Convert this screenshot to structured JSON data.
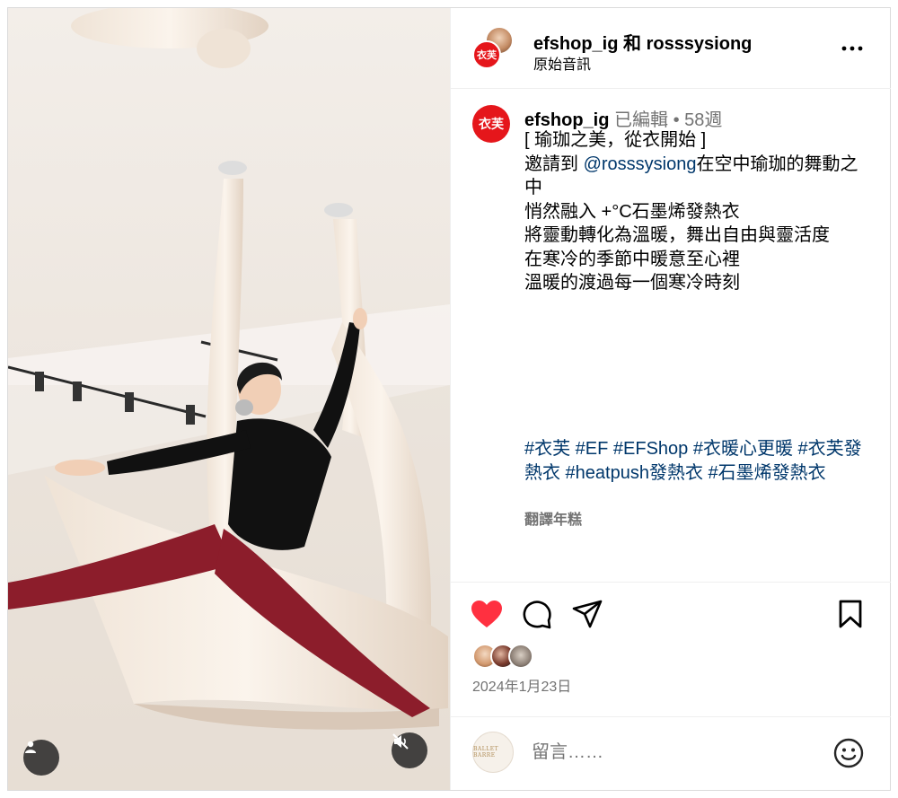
{
  "post": {
    "media": {
      "alt_scene": "aerial-yoga",
      "user_button_icon": "user-icon",
      "mute_button_icon": "muted-speaker-icon"
    },
    "header": {
      "collab_avatar_text": "衣芙",
      "title": "efshop_ig 和 rosssysiong",
      "subtitle": "原始音訊",
      "more_icon": "more-horizontal-icon"
    },
    "caption": {
      "avatar_text": "衣芙",
      "username": "efshop_ig",
      "edited": "已編輯",
      "dot": "•",
      "age": "58週",
      "lines": [
        "[ 瑜珈之美，從衣開始 ]",
        "在空中瑜珈的舞動之中",
        "悄然融入 +°C石墨烯發熱衣",
        "將靈動轉化為溫暖，舞出自由與靈活度",
        "在寒冷的季節中暖意至心裡",
        "溫暖的渡過每一個寒冷時刻"
      ],
      "invite_prefix": "邀請到 ",
      "mention": "@rosssysiong",
      "hashtags": "#衣芙 #EF #EFShop #衣暖心更暖 #衣芙發熱衣 #heatpush發熱衣 #石墨烯發熱衣",
      "translate": "翻譯年糕"
    },
    "actions": {
      "like_icon": "heart-filled-icon",
      "comment_icon": "comment-icon",
      "share_icon": "send-icon",
      "save_icon": "bookmark-icon",
      "like_color": "#ff3040"
    },
    "date": "2024年1月23日",
    "comment_box": {
      "avatar_text": "BALLET BARRE",
      "placeholder": "留言……",
      "emoji_icon": "smiley-icon"
    }
  }
}
